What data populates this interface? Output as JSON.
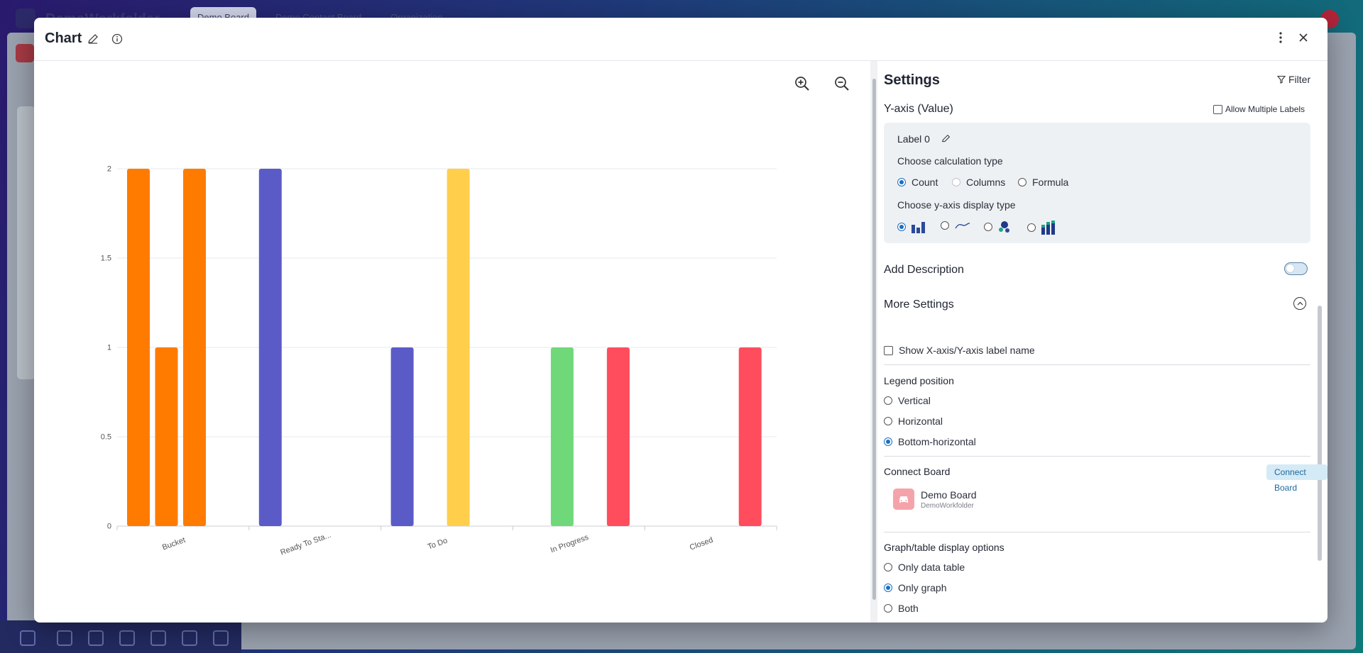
{
  "background": {
    "brand": "DemoWorkfolder",
    "tabs": [
      "Demo Board",
      "Demo Contact Board",
      "Organization"
    ],
    "search_hint": "N"
  },
  "modal": {
    "title": "Chart"
  },
  "chart_data": {
    "type": "bar",
    "categories": [
      "Bucket",
      "Ready To Sta...",
      "To Do",
      "In Progress",
      "Closed"
    ],
    "ylim": [
      0,
      2
    ],
    "yticks": [
      "0",
      "0.5",
      "1",
      "1.5",
      "2"
    ],
    "grid": true,
    "bars": [
      {
        "category": 0,
        "slot": 0,
        "value": 2,
        "color": "#ff7b00"
      },
      {
        "category": 0,
        "slot": 1,
        "value": 1,
        "color": "#ff7b00"
      },
      {
        "category": 0,
        "slot": 2,
        "value": 2,
        "color": "#ff7b00"
      },
      {
        "category": 1,
        "slot": 0,
        "value": 2,
        "color": "#5b5bc8"
      },
      {
        "category": 2,
        "slot": 0,
        "value": 1,
        "color": "#5b5bc8"
      },
      {
        "category": 2,
        "slot": 2,
        "value": 2,
        "color": "#ffce4a"
      },
      {
        "category": 3,
        "slot": 1,
        "value": 1,
        "color": "#6fd97a"
      },
      {
        "category": 3,
        "slot": 3,
        "value": 1,
        "color": "#ff4d5e"
      },
      {
        "category": 4,
        "slot": 3,
        "value": 1,
        "color": "#ff4d5e"
      }
    ]
  },
  "settings": {
    "title": "Settings",
    "filter_label": "Filter",
    "yaxis_title": "Y-axis (Value)",
    "allow_multiple_labels": "Allow Multiple Labels",
    "label_name": "Label 0",
    "calc_type_label": "Choose calculation type",
    "calc_options": [
      "Count",
      "Columns",
      "Formula"
    ],
    "calc_selected": "Count",
    "display_type_label": "Choose y-axis display type",
    "display_type_icons": [
      "bar-chart-icon",
      "line-chart-icon",
      "bubble-chart-icon",
      "stacked-bar-icon"
    ],
    "add_description": "Add Description",
    "more_settings": "More Settings",
    "show_axis_label": "Show X-axis/Y-axis label name",
    "legend_position_label": "Legend position",
    "legend_options": [
      "Vertical",
      "Horizontal",
      "Bottom-horizontal"
    ],
    "legend_selected": "Bottom-horizontal",
    "connect_board_label": "Connect Board",
    "connect_board_button": "Connect Board",
    "board_name": "Demo Board",
    "board_workspace": "DemoWorkfolder",
    "display_options_label": "Graph/table display options",
    "display_options": [
      "Only data table",
      "Only graph",
      "Both"
    ],
    "display_selected": "Only graph"
  }
}
